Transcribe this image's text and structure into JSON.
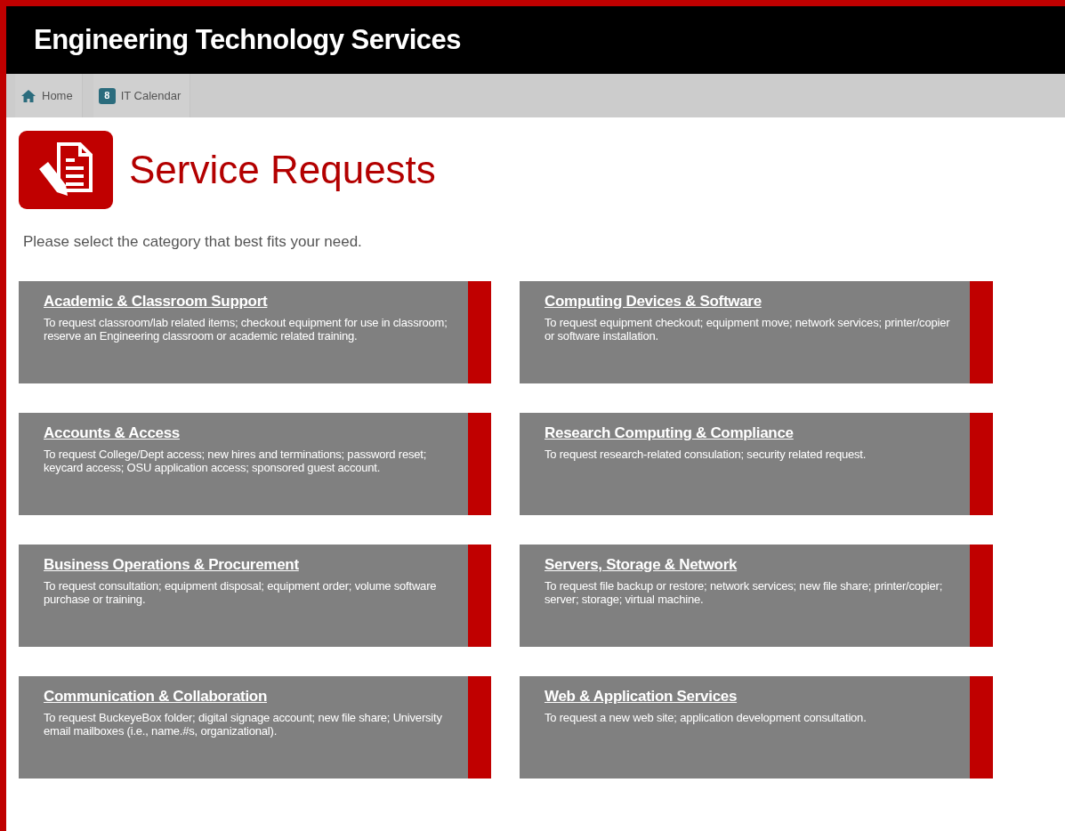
{
  "header": {
    "title": "Engineering Technology Services"
  },
  "nav": {
    "items": [
      {
        "label": "Home",
        "kind": "home"
      },
      {
        "label": "IT Calendar",
        "kind": "calendar",
        "day": "8"
      }
    ]
  },
  "page": {
    "title": "Service Requests",
    "intro": "Please select the category that best fits your need."
  },
  "categories": [
    {
      "title": "Academic & Classroom Support",
      "description": "To request classroom/lab related items; checkout equipment for use in classroom; reserve an Engineering classroom or academic related training."
    },
    {
      "title": "Computing Devices & Software",
      "description": "To request equipment checkout; equipment move; network services; printer/copier or software installation."
    },
    {
      "title": "Accounts & Access",
      "description": "To request College/Dept access; new hires and terminations; password reset; keycard access; OSU application access; sponsored guest account."
    },
    {
      "title": "Research Computing & Compliance",
      "description": "To request research-related consulation; security related request."
    },
    {
      "title": "Business Operations & Procurement",
      "description": "To request consultation; equipment disposal; equipment order; volume software purchase or training."
    },
    {
      "title": "Servers, Storage & Network",
      "description": "To request file backup or restore; network services; new file share; printer/copier; server; storage; virtual machine."
    },
    {
      "title": "Communication & Collaboration",
      "description": "To request BuckeyeBox folder; digital signage account; new file share; University email mailboxes (i.e., name.#s, organizational)."
    },
    {
      "title": "Web & Application Services",
      "description": "To request a new web site; application development consultation."
    }
  ]
}
